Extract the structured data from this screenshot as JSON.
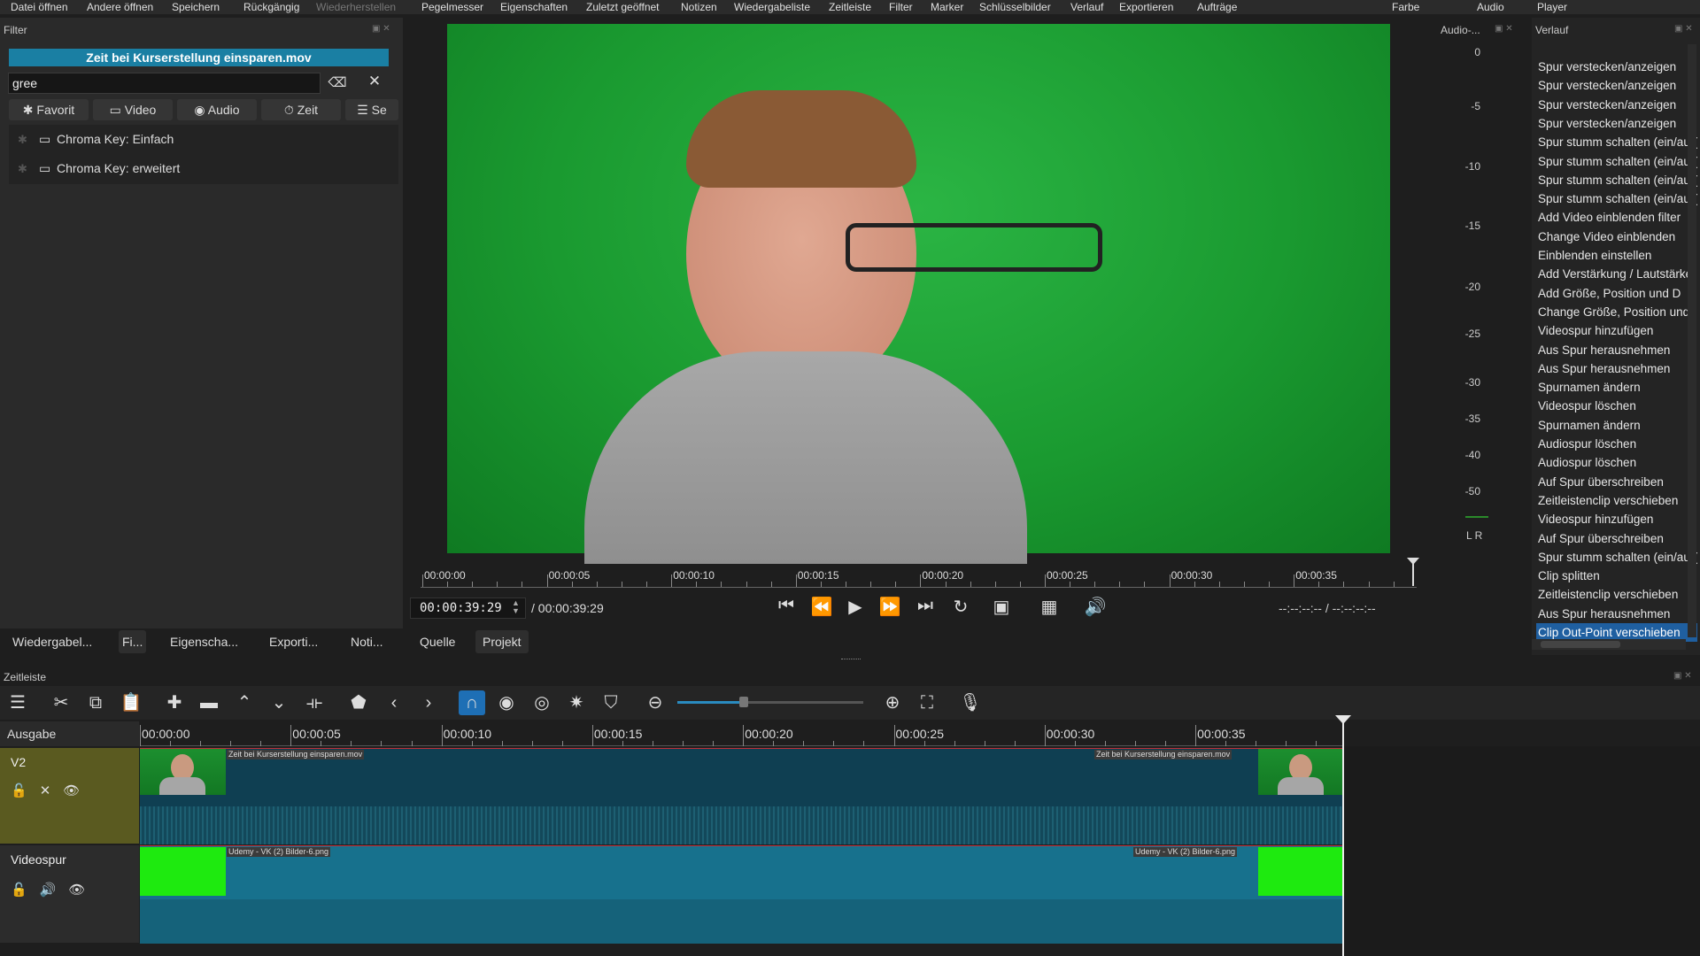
{
  "menubar": {
    "items": [
      "Datei öffnen",
      "Andere öffnen",
      "Speichern",
      "Rückgängig",
      "Wiederherstellen",
      "Pegelmesser",
      "Eigenschaften",
      "Zuletzt geöffnet",
      "Notizen",
      "Wiedergabeliste",
      "Zeitleiste",
      "Filter",
      "Marker",
      "Schlüsselbilder",
      "Verlauf",
      "Exportieren",
      "Aufträge"
    ],
    "right_items": [
      "Farbe",
      "Audio",
      "Player"
    ]
  },
  "filter_panel": {
    "title": "Filter",
    "clip_name": "Zeit bei Kurserstellung einsparen.mov",
    "search_value": "gree",
    "categories": [
      "Favorit",
      "Video",
      "Audio",
      "Zeit",
      "Se"
    ],
    "results": [
      "Chroma Key: Einfach",
      "Chroma Key: erweitert"
    ]
  },
  "bottom_tabs": [
    "Wiedergabel...",
    "Fi...",
    "Eigenscha...",
    "Exporti...",
    "Noti..."
  ],
  "player": {
    "ruler_labels": [
      "00:00:00",
      "00:00:05",
      "00:00:10",
      "00:00:15",
      "00:00:20",
      "00:00:25",
      "00:00:30",
      "00:00:35"
    ],
    "timecode": "00:00:39:29",
    "total": "/ 00:00:39:29",
    "inout": "--:--:--:-- / --:--:--:--",
    "source_tabs": [
      "Quelle",
      "Projekt"
    ]
  },
  "audio_meter": {
    "title": "Audio-...",
    "labels": [
      "0",
      "-5",
      "-10",
      "-15",
      "-20",
      "-25",
      "-30",
      "-35",
      "-40",
      "-50"
    ],
    "channels": "L R"
  },
  "history": {
    "title": "Verlauf",
    "items": [
      "Spur verstecken/anzeigen",
      "Spur verstecken/anzeigen",
      "Spur verstecken/anzeigen",
      "Spur verstecken/anzeigen",
      "Spur stumm schalten (ein/aus)",
      "Spur stumm schalten (ein/aus)",
      "Spur stumm schalten (ein/aus)",
      "Spur stumm schalten (ein/aus)",
      "Add Video einblenden filter",
      "Change Video einblenden",
      "Einblenden einstellen",
      "Add Verstärkung / Lautstärke",
      "Add Größe, Position und D",
      "Change Größe, Position und",
      "Videospur hinzufügen",
      "Aus Spur herausnehmen",
      "Aus Spur herausnehmen",
      "Spurnamen ändern",
      "Videospur löschen",
      "Spurnamen ändern",
      "Audiospur löschen",
      "Audiospur löschen",
      "Auf Spur überschreiben",
      "Zeitleistenclip verschieben",
      "Videospur hinzufügen",
      "Auf Spur überschreiben",
      "Spur stumm schalten (ein/aus)",
      "Clip splitten",
      "Zeitleistenclip verschieben",
      "Aus Spur herausnehmen",
      "Clip Out-Point verschieben"
    ],
    "selected_index": 30
  },
  "timeline": {
    "title": "Zeitleiste",
    "output_label": "Ausgabe",
    "ruler_labels": [
      "00:00:00",
      "00:00:05",
      "00:00:10",
      "00:00:15",
      "00:00:20",
      "00:00:25",
      "00:00:30",
      "00:00:35"
    ],
    "tracks": [
      {
        "name": "V2",
        "clip_left": "Zeit bei Kurserstellung einsparen.mov",
        "clip_right": "Zeit bei Kurserstellung einsparen.mov"
      },
      {
        "name": "Videospur",
        "clip_left": "Udemy - VK (2) Bilder-6.png",
        "clip_right": "Udemy - VK (2) Bilder-6.png"
      }
    ]
  },
  "colors": {
    "accent": "#1e6fb5",
    "clip_title_bg": "#1a7fa3",
    "green_screen": "#1a9a30",
    "lane": "#0f3f52"
  }
}
